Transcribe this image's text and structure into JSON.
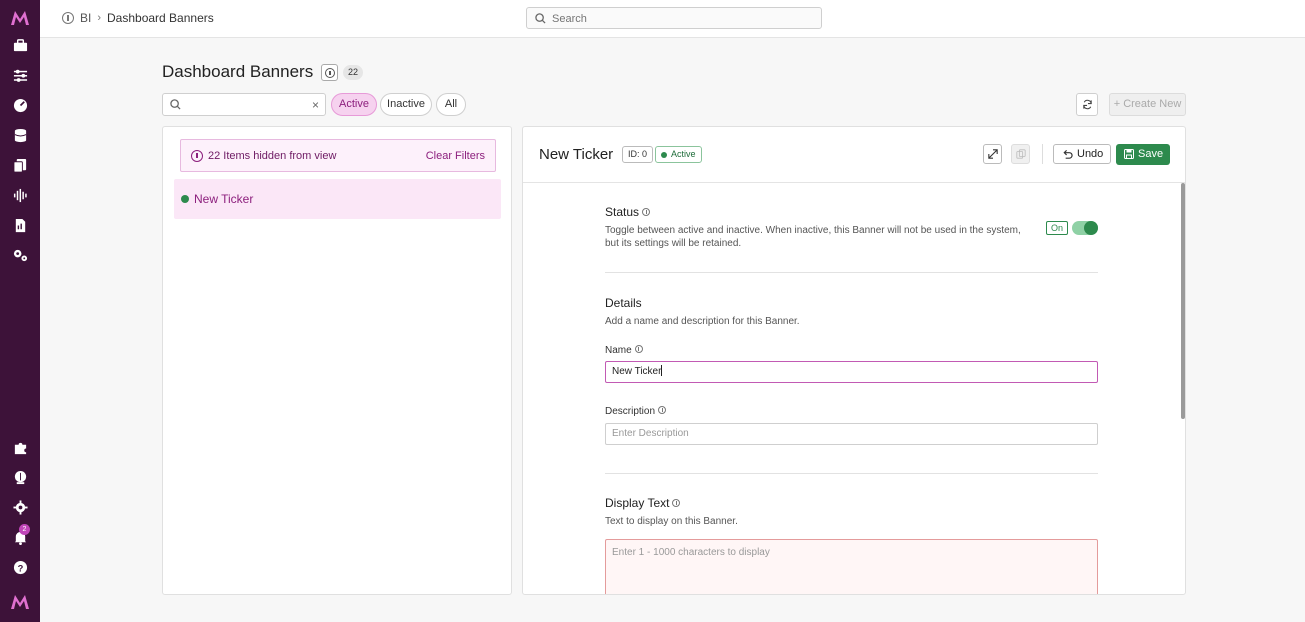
{
  "rail": {
    "icons": [
      "logo-icon",
      "briefcase-icon",
      "sliders-icon",
      "gauge-icon",
      "database-icon",
      "documents-icon",
      "waveform-icon",
      "report-icon",
      "gears-icon",
      "puzzle-icon",
      "brain-icon",
      "settings-icon",
      "bell-icon",
      "help-icon",
      "logo-bottom-icon"
    ],
    "notification_count": "2",
    "brand_color": "#3d1239"
  },
  "topbar": {
    "breadcrumb_root": "BI",
    "breadcrumb_sep": "›",
    "breadcrumb_current": "Dashboard Banners",
    "search_placeholder": "Search"
  },
  "header": {
    "title": "Dashboard Banners",
    "count": "22",
    "filter_search_value": "",
    "clear_glyph": "×",
    "chips": [
      "Active",
      "Inactive",
      "All"
    ],
    "active_chip": "Active",
    "create_label": "+ Create New"
  },
  "list": {
    "hidden_text": "22 Items hidden from view",
    "clear_filters": "Clear Filters",
    "items": [
      {
        "label": "New Ticker",
        "status": "active"
      }
    ]
  },
  "detail": {
    "title": "New Ticker",
    "id_label": "ID: 0",
    "status_label": "Active",
    "undo_label": "Undo",
    "save_label": "Save",
    "status_section": {
      "title": "Status",
      "desc": "Toggle between active and inactive. When inactive, this Banner will not be used in the system, but its settings will be retained.",
      "toggle_label": "On",
      "toggle_on": true
    },
    "details_section": {
      "title": "Details",
      "desc": "Add a name and description for this Banner.",
      "name_label": "Name",
      "name_value": "New Ticker",
      "description_label": "Description",
      "description_placeholder": "Enter Description"
    },
    "display_section": {
      "title": "Display Text",
      "desc": "Text to display on this Banner.",
      "placeholder": "Enter 1 - 1000 characters to display"
    }
  },
  "colors": {
    "accent": "#c25ab4",
    "success": "#2d8a4d",
    "chip_active_bg": "#f6d2ef"
  }
}
